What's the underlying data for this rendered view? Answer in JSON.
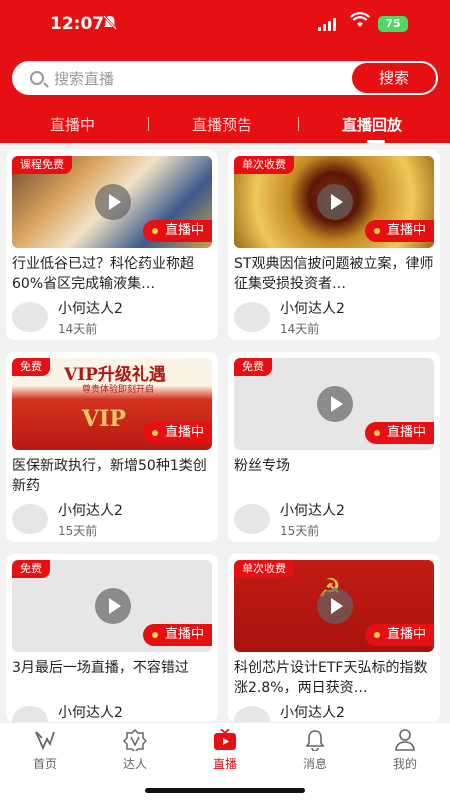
{
  "status_bar": {
    "time": "12:07",
    "battery": "75"
  },
  "search": {
    "placeholder": "搜索直播",
    "button": "搜索"
  },
  "tabs": [
    {
      "label": "直播中",
      "active": false
    },
    {
      "label": "直播预告",
      "active": false
    },
    {
      "label": "直播回放",
      "active": true
    }
  ],
  "cards": [
    {
      "badge": "课程免费",
      "status": "直播中",
      "title": "行业低谷已过？科伦药业称超60%省区完成输液集…",
      "author": "小何达人2",
      "ago": "14天前"
    },
    {
      "badge": "单次收费",
      "status": "直播中",
      "title": "ST观典因信披问题被立案，律师征集受损投资者…",
      "author": "小何达人2",
      "ago": "14天前"
    },
    {
      "badge": "免费",
      "status": "直播中",
      "title": "医保新政执行，新增50种1类创新药",
      "author": "小何达人2",
      "ago": "15天前",
      "thumb_text": {
        "main": "VIP升级礼遇",
        "sub": "尊贵体验即刻开启",
        "vip": "VIP"
      }
    },
    {
      "badge": "免费",
      "status": "直播中",
      "title": "粉丝专场",
      "author": "小何达人2",
      "ago": "15天前"
    },
    {
      "badge": "免费",
      "status": "直播中",
      "title": "3月最后一场直播，不容错过",
      "author": "小何达人2",
      "ago": ""
    },
    {
      "badge": "单次收费",
      "status": "直播中",
      "title": "科创芯片设计ETF天弘标的指数涨2.8%，两日获资…",
      "author": "小何达人2",
      "ago": ""
    }
  ],
  "nav": [
    {
      "label": "首页",
      "icon": "home-icon"
    },
    {
      "label": "达人",
      "icon": "star-badge-icon"
    },
    {
      "label": "直播",
      "icon": "tv-icon",
      "active": true
    },
    {
      "label": "消息",
      "icon": "bell-icon"
    },
    {
      "label": "我的",
      "icon": "user-icon"
    }
  ],
  "colors": {
    "accent": "#e60f12",
    "live_dot": "#ffd24d"
  }
}
